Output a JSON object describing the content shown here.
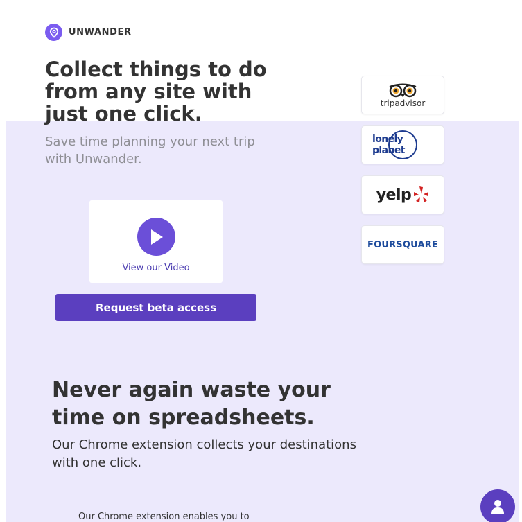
{
  "brand": {
    "name": "UNWANDER",
    "logo_icon": "location-pin-icon",
    "accent": "#7b5cf0"
  },
  "hero": {
    "title": "Collect things to do from any site with just one click.",
    "subtitle": "Save time planning your next trip with Unwander."
  },
  "video": {
    "label": "View our Video",
    "icon": "play-icon"
  },
  "cta": {
    "label": "Request beta access",
    "color": "#5b3fbf"
  },
  "sources": {
    "tripadvisor": "tripadvisor",
    "lonely_planet": "lonely planet",
    "yelp": "yelp",
    "foursquare": "FOURSQUARE"
  },
  "features": {
    "title": "Never again waste your time on spreadsheets.",
    "subtitle": "Our Chrome extension collects your destinations with one click.",
    "body_partial": "Our Chrome extension enables you to"
  },
  "chat": {
    "icon": "user-icon"
  },
  "colors": {
    "section_bg": "#ece9fc",
    "text": "#333333",
    "muted": "#8f8f95"
  }
}
